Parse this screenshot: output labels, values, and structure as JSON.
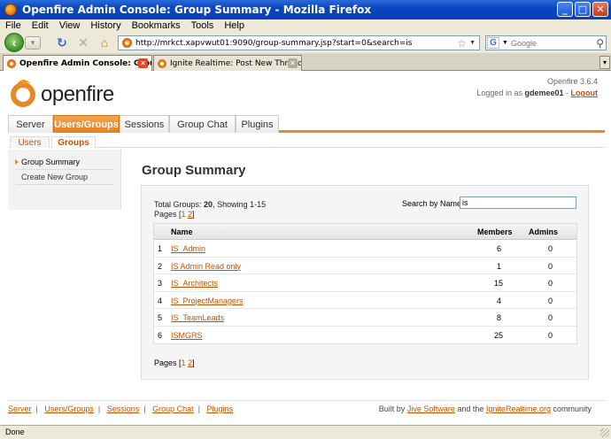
{
  "browser": {
    "window_title": "Openfire Admin Console: Group Summary - Mozilla Firefox",
    "menu": [
      "File",
      "Edit",
      "View",
      "History",
      "Bookmarks",
      "Tools",
      "Help"
    ],
    "url": "http://mrkct.xapvwut01:9090/group-summary.jsp?start=0&search=is",
    "search_placeholder": "Google",
    "tabs": [
      {
        "label": "Openfire Admin Console: Group S...",
        "active": true
      },
      {
        "label": "Ignite Realtime: Post New Thread",
        "active": false
      }
    ],
    "status": "Done"
  },
  "app": {
    "brand": "openfire",
    "version": "Openfire 3.6.4",
    "login_prefix": "Logged in as",
    "user": "gdemee01",
    "logout": "Logout",
    "main_nav": [
      "Server",
      "Users/Groups",
      "Sessions",
      "Group Chat",
      "Plugins"
    ],
    "sub_nav": [
      "Users",
      "Groups"
    ],
    "sidebar": [
      "Group Summary",
      "Create New Group"
    ],
    "page_title": "Group Summary",
    "summary": {
      "total_label": "Total Groups:",
      "total": "20",
      "showing": ", Showing 1-15",
      "pages_label": "Pages [",
      "page1": "1",
      "page2": "2",
      "pages_close": "]"
    },
    "search": {
      "label": "Search by Name:",
      "value": "is"
    },
    "table": {
      "headers": {
        "name": "Name",
        "members": "Members",
        "admins": "Admins"
      },
      "rows": [
        {
          "num": "1",
          "name": "IS_Admin",
          "members": "6",
          "admins": "0"
        },
        {
          "num": "2",
          "name": "IS Admin Read only",
          "members": "1",
          "admins": "0"
        },
        {
          "num": "3",
          "name": "IS_Architects",
          "members": "15",
          "admins": "0"
        },
        {
          "num": "4",
          "name": "IS_ProjectManagers",
          "members": "4",
          "admins": "0"
        },
        {
          "num": "5",
          "name": "IS_TeamLeads",
          "members": "8",
          "admins": "0"
        },
        {
          "num": "6",
          "name": "ISMGRS",
          "members": "25",
          "admins": "0"
        }
      ]
    },
    "footer": {
      "links": [
        "Server",
        "Users/Groups",
        "Sessions",
        "Group Chat",
        "Plugins"
      ],
      "credit_prefix": "Built by",
      "credit_link1": "Jive Software",
      "credit_mid": "and the",
      "credit_link2": "IgniteRealtime.org",
      "credit_suffix": "community"
    }
  },
  "colors": {
    "accent": "#e58a26",
    "link": "#c35200",
    "titlebar": "#0a46c4"
  }
}
